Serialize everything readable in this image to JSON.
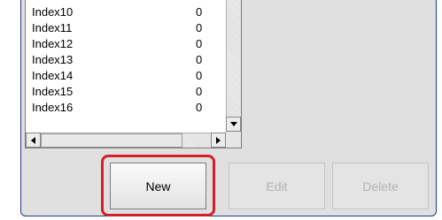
{
  "list": {
    "rows": [
      {
        "name": "Index10",
        "value": "0"
      },
      {
        "name": "Index11",
        "value": "0"
      },
      {
        "name": "Index12",
        "value": "0"
      },
      {
        "name": "Index13",
        "value": "0"
      },
      {
        "name": "Index14",
        "value": "0"
      },
      {
        "name": "Index15",
        "value": "0"
      },
      {
        "name": "Index16",
        "value": "0"
      }
    ]
  },
  "buttons": {
    "new_label": "New",
    "edit_label": "Edit",
    "delete_label": "Delete"
  },
  "colors": {
    "panel_bg": "#e0e0e0",
    "highlight": "#d42027",
    "panel_border": "#1e3a8a"
  },
  "icons": {
    "scroll_down": "arrow-down",
    "scroll_left": "arrow-left",
    "scroll_right": "arrow-right"
  }
}
